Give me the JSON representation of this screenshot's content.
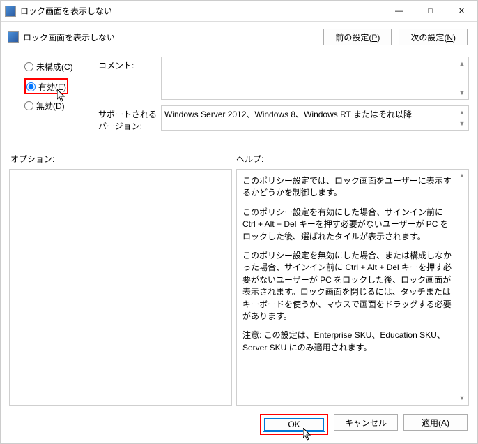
{
  "window": {
    "title": "ロック画面を表示しない"
  },
  "toolbar": {
    "title": "ロック画面を表示しない",
    "prev_button": "前の設定(P)",
    "next_button": "次の設定(N)"
  },
  "radios": {
    "not_configured": "未構成(C)",
    "enabled": "有効(E)",
    "disabled": "無効(D)",
    "selected": "enabled"
  },
  "fields": {
    "comment_label": "コメント:",
    "comment_value": "",
    "version_label": "サポートされるバージョン:",
    "version_value": "Windows Server 2012、Windows 8、Windows RT またはそれ以降"
  },
  "sections": {
    "options_label": "オプション:",
    "help_label": "ヘルプ:"
  },
  "help": {
    "p1": "このポリシー設定では、ロック画面をユーザーに表示するかどうかを制御します。",
    "p2": "このポリシー設定を有効にした場合、サインイン前に Ctrl + Alt + Del キーを押す必要がないユーザーが PC をロックした後、選ばれたタイルが表示されます。",
    "p3": "このポリシー設定を無効にした場合、または構成しなかった場合、サインイン前に Ctrl + Alt + Del キーを押す必要がないユーザーが PC をロックした後、ロック画面が表示されます。ロック画面を閉じるには、タッチまたはキーボードを使うか、マウスで画面をドラッグする必要があります。",
    "p4": "注意: この設定は、Enterprise SKU、Education SKU、Server SKU にのみ適用されます。"
  },
  "buttons": {
    "ok": "OK",
    "cancel": "キャンセル",
    "apply": "適用(A)"
  }
}
